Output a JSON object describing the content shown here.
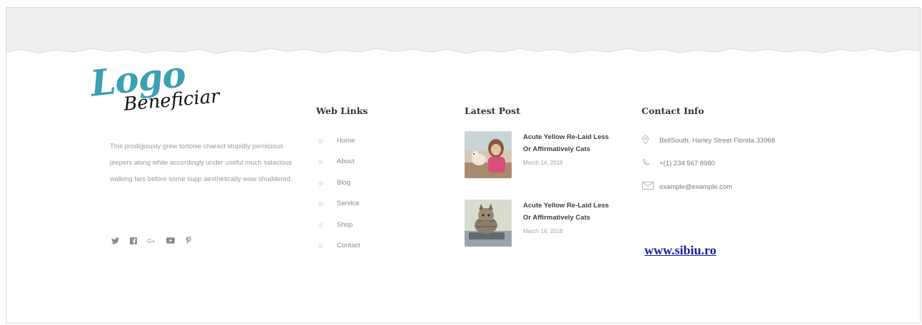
{
  "logo": {
    "main": "Logo",
    "sub": "Beneficiar",
    "color": "#3aa0b2"
  },
  "about": {
    "text": "This prodigiously grew tortoise charact stupidly pernicious jeepers along while accordingly under useful much salacious walking fars before some supp aesthetically wow shuddered."
  },
  "social": [
    {
      "icon": "twitter-icon",
      "glyph": "❦"
    },
    {
      "icon": "facebook-icon",
      "glyph": "f"
    },
    {
      "icon": "google-plus-icon",
      "glyph": "G+"
    },
    {
      "icon": "youtube-icon",
      "glyph": "▶"
    },
    {
      "icon": "pinterest-icon",
      "glyph": "P"
    }
  ],
  "web_links": {
    "title": "Web Links",
    "items": [
      {
        "label": "Home"
      },
      {
        "label": "About"
      },
      {
        "label": "Blog"
      },
      {
        "label": "Service"
      },
      {
        "label": "Shop"
      },
      {
        "label": "Contact"
      }
    ]
  },
  "latest_post": {
    "title": "Latest Post",
    "posts": [
      {
        "title": "Acute Yellow Re-Laid Less Or Affirmatively Cats",
        "date": "March 14, 2018",
        "image": "woman-with-dog-photo"
      },
      {
        "title": "Acute Yellow Re-Laid Less Or Affirmatively Cats",
        "date": "March 14, 2018",
        "image": "cat-on-laptop-photo"
      }
    ]
  },
  "contact_info": {
    "title": "Contact Info",
    "address": "BellSouth, Harley Street Florida 33968",
    "phone": "+(1) 234 567 8980",
    "email": "example@example.com"
  },
  "website": {
    "label": "www.sibiu.ro"
  }
}
